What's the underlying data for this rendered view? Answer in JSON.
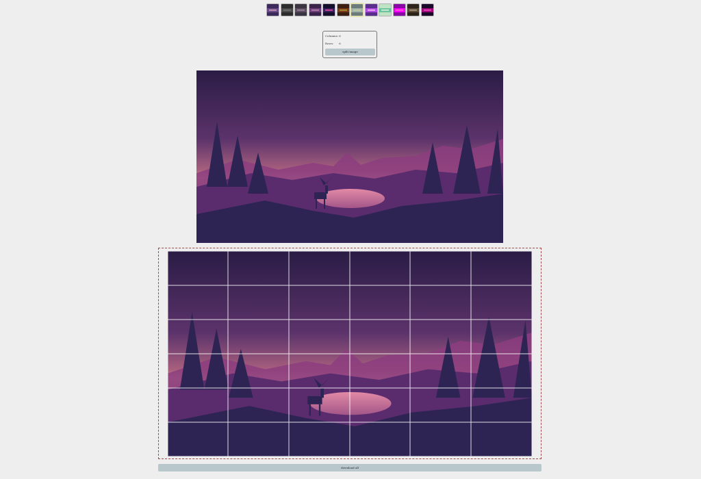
{
  "thumbnails": [
    {
      "name": "thumb-1",
      "theme": "violet-dusk"
    },
    {
      "name": "thumb-2",
      "theme": "dark-gray"
    },
    {
      "name": "thumb-3",
      "theme": "gray-mauve"
    },
    {
      "name": "thumb-4",
      "theme": "purple-pink"
    },
    {
      "name": "thumb-5",
      "theme": "night-magenta"
    },
    {
      "name": "thumb-6",
      "theme": "red-olive"
    },
    {
      "name": "thumb-7",
      "theme": "gray-green",
      "active": true
    },
    {
      "name": "thumb-8",
      "theme": "violet-glow"
    },
    {
      "name": "thumb-9",
      "theme": "mint"
    },
    {
      "name": "thumb-10",
      "theme": "magenta"
    },
    {
      "name": "thumb-11",
      "theme": "brown"
    },
    {
      "name": "thumb-12",
      "theme": "dark-magenta"
    }
  ],
  "controls": {
    "columns_label": "Columns:",
    "columns_value": "6",
    "rows_label": "Rows:",
    "rows_value": "6",
    "split_button": "split image"
  },
  "download_label": "download all",
  "grid": {
    "columns": 6,
    "rows": 6
  },
  "colors": {
    "accent_button": "#b7c7cc",
    "dashed_border": "#9c4a4a",
    "sky_top": "#2a1c45",
    "sky_mid": "#6b3a72",
    "horizon": "#c57a8a",
    "mountains": "#8a3a7a",
    "forest": "#2d2453"
  }
}
